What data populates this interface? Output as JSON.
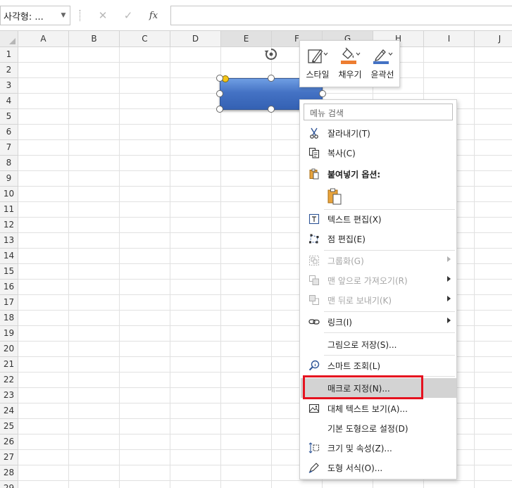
{
  "formula_bar": {
    "name_box": "사각형: ...",
    "cancel_symbol": "✕",
    "enter_symbol": "✓",
    "fx_symbol": "fx"
  },
  "columns": [
    "A",
    "B",
    "C",
    "D",
    "E",
    "F",
    "G",
    "H",
    "I",
    "J"
  ],
  "rows": [
    "1",
    "2",
    "3",
    "4",
    "5",
    "6",
    "7",
    "8",
    "9",
    "10",
    "11",
    "12",
    "13",
    "14",
    "15",
    "16",
    "17",
    "18",
    "19",
    "20",
    "21",
    "22",
    "23",
    "24",
    "25",
    "26",
    "27",
    "28",
    "29"
  ],
  "mini_toolbar": {
    "items": [
      {
        "label": "스타일",
        "icon": "shape-style-icon"
      },
      {
        "label": "채우기",
        "icon": "fill-bucket-icon"
      },
      {
        "label": "윤곽선",
        "icon": "outline-pen-icon"
      }
    ],
    "colors": {
      "fill": "#ed7d31",
      "outline": "#4472c4"
    }
  },
  "context_menu": {
    "search_placeholder": "메뉴 검색",
    "items": [
      {
        "label": "잘라내기(T)",
        "icon": "scissors-icon"
      },
      {
        "label": "복사(C)",
        "icon": "copy-icon"
      },
      {
        "label": "붙여넣기 옵션:",
        "icon": "paste-icon"
      },
      {
        "label": "텍스트 편집(X)",
        "icon": "edit-text-icon"
      },
      {
        "label": "점 편집(E)",
        "icon": "edit-points-icon"
      },
      {
        "label": "그룹화(G)",
        "icon": "group-icon"
      },
      {
        "label": "맨 앞으로 가져오기(R)",
        "icon": "bring-front-icon"
      },
      {
        "label": "맨 뒤로 보내기(K)",
        "icon": "send-back-icon"
      },
      {
        "label": "링크(I)",
        "icon": "link-icon"
      },
      {
        "label": "그림으로 저장(S)...",
        "icon": ""
      },
      {
        "label": "스마트 조회(L)",
        "icon": "smart-lookup-icon"
      },
      {
        "label": "매크로 지정(N)...",
        "icon": ""
      },
      {
        "label": "대체 텍스트 보기(A)...",
        "icon": "alt-text-icon"
      },
      {
        "label": "기본 도형으로 설정(D)",
        "icon": ""
      },
      {
        "label": "크기 및 속성(Z)...",
        "icon": "size-properties-icon"
      },
      {
        "label": "도형 서식(O)...",
        "icon": "format-shape-icon"
      }
    ]
  },
  "colors": {
    "shape_fill": "#4472c4",
    "highlight_box": "#e5121f",
    "selection_handle": "#f5c518"
  }
}
